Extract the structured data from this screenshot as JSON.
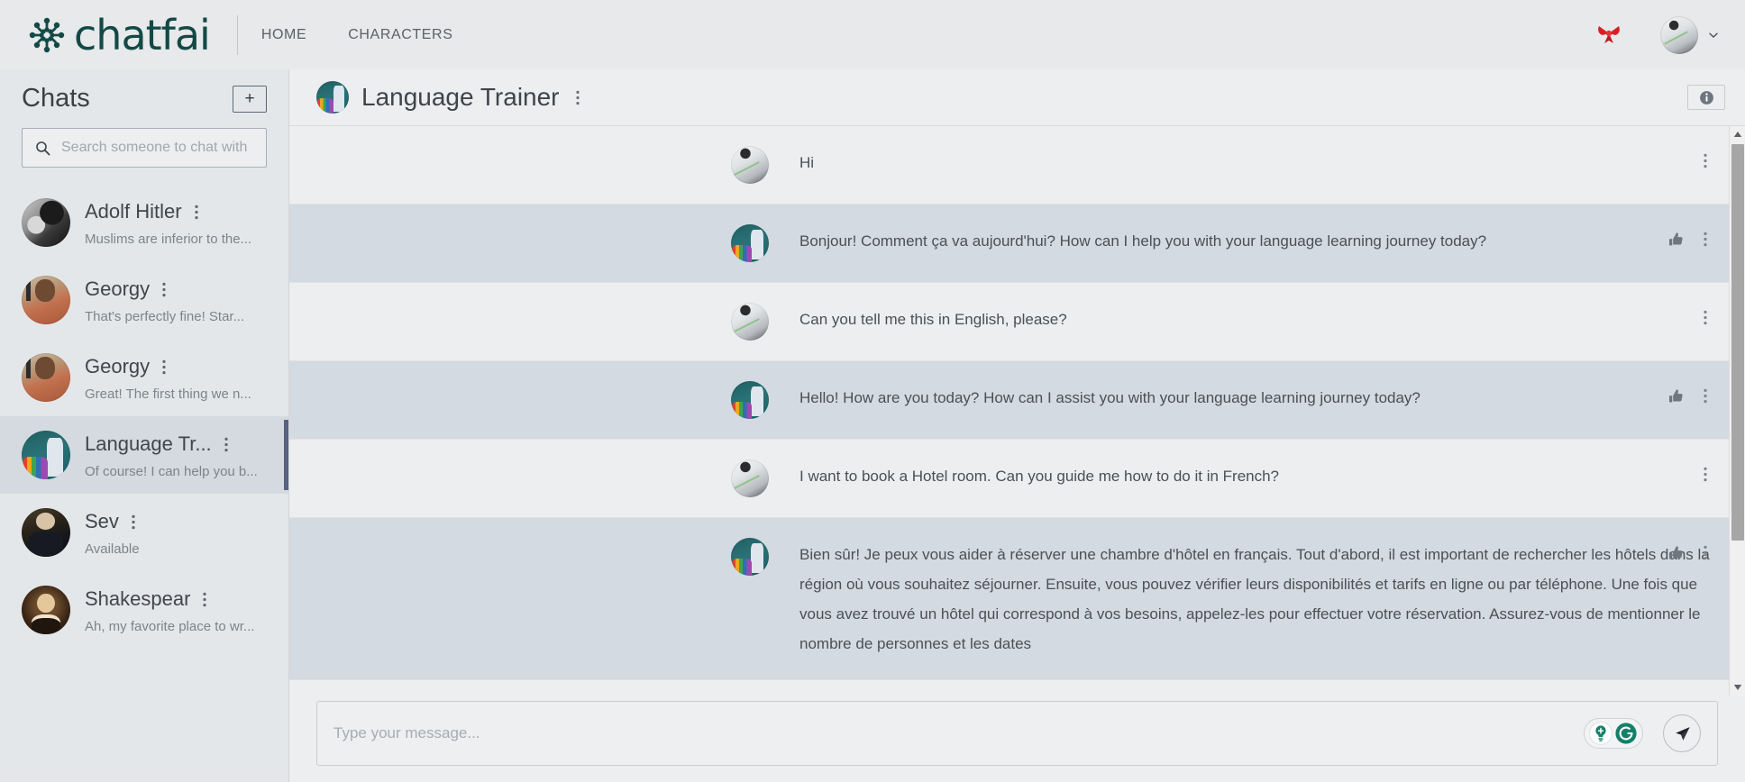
{
  "header": {
    "brand_text": "chatfai",
    "brand_icon": "chatfai-neural-logo",
    "nav": [
      {
        "label": "HOME"
      },
      {
        "label": "CHARACTERS"
      }
    ],
    "ribbon_icon": "red-ribbon-icon",
    "avatar_icon": "user-avatar",
    "chevron_icon": "chevron-down-icon"
  },
  "sidebar": {
    "title": "Chats",
    "add_label": "+",
    "search": {
      "placeholder": "Search someone to chat with",
      "value": "",
      "icon": "search-icon"
    },
    "items": [
      {
        "name": "Adolf Hitler",
        "snippet": "Muslims are inferior to the...",
        "avatar": "av-hitler",
        "active": false
      },
      {
        "name": "Georgy",
        "snippet": "That's perfectly fine! Star...",
        "avatar": "av-georgy",
        "active": false
      },
      {
        "name": "Georgy",
        "snippet": "Great! The first thing we n...",
        "avatar": "av-georgy",
        "active": false
      },
      {
        "name": "Language Tr...",
        "snippet": "Of course! I can help you b...",
        "avatar": "av-teacher",
        "active": true
      },
      {
        "name": "Sev",
        "snippet": "Available",
        "avatar": "av-sev",
        "active": false
      },
      {
        "name": "Shakespear",
        "snippet": "Ah, my favorite place to wr...",
        "avatar": "av-shake",
        "active": false
      }
    ]
  },
  "chat": {
    "title": "Language Trainer",
    "avatar": "av-teacher",
    "kebab_icon": "kebab-menu-icon",
    "info_icon": "info-icon",
    "messages": [
      {
        "role": "user",
        "avatar": "av-user",
        "text": "Hi",
        "has_like": false
      },
      {
        "role": "bot",
        "avatar": "av-teacher",
        "text": "Bonjour! Comment ça va aujourd'hui? How can I help you with your language learning journey today?",
        "has_like": true
      },
      {
        "role": "user",
        "avatar": "av-user",
        "text": "Can you tell me this in English, please?",
        "has_like": false
      },
      {
        "role": "bot",
        "avatar": "av-teacher",
        "text": "Hello! How are you today? How can I assist you with your language learning journey today?",
        "has_like": true
      },
      {
        "role": "user",
        "avatar": "av-user",
        "text": "I want to book a Hotel room. Can you guide me how to do it in French?",
        "has_like": false
      },
      {
        "role": "bot",
        "avatar": "av-teacher",
        "text": "Bien sûr! Je peux vous aider à réserver une chambre d'hôtel en français. Tout d'abord, il est important de rechercher les hôtels dans la région où vous souhaitez séjourner. Ensuite, vous pouvez vérifier leurs disponibilités et tarifs en ligne ou par téléphone. Une fois que vous avez trouvé un hôtel qui correspond à vos besoins, appelez-les pour effectuer votre réservation. Assurez-vous de mentionner le nombre de personnes et les dates",
        "has_like": true
      }
    ]
  },
  "composer": {
    "placeholder": "Type your message...",
    "value": "",
    "grammarly_bulb_icon": "grammarly-lightbulb-icon",
    "grammarly_circle_icon": "grammarly-logo-icon",
    "send_icon": "send-paper-plane-icon"
  },
  "colors": {
    "brand": "#124946",
    "accent_bar": "#58627e",
    "bot_row": "#d3dae1",
    "user_row": "#eceeef",
    "sidebar_bg": "#e4e7e9",
    "topnav_bg": "#e7e9ea",
    "grammarly_green": "#15806a",
    "ribbon_red": "#d81f26"
  }
}
